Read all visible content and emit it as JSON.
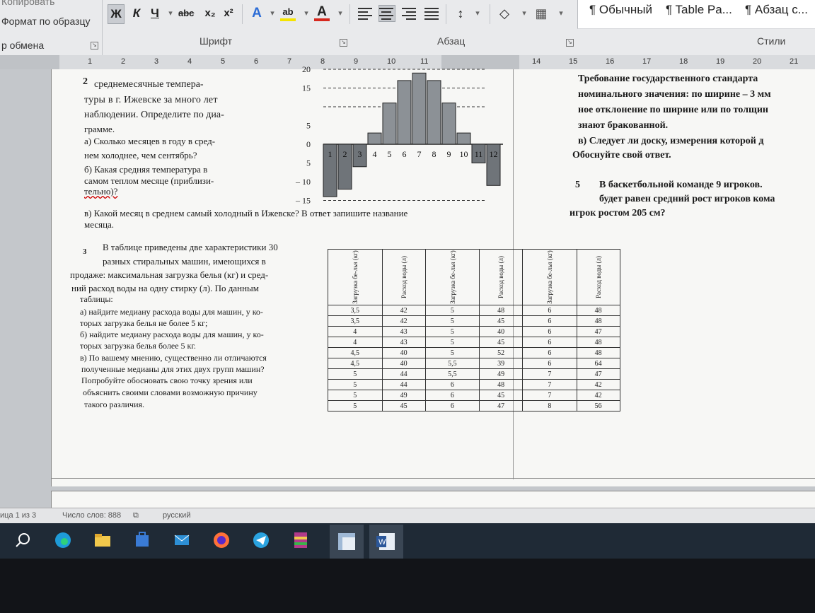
{
  "ribbon": {
    "clipboard": {
      "copy": "Копировать",
      "format_painter": "Формат по образцу",
      "group": "р обмена"
    },
    "font": {
      "group": "Шрифт",
      "bold": "Ж",
      "italic": "К",
      "underline": "Ч",
      "strike": "abc",
      "subscript": "x₂",
      "superscript": "x²",
      "text_effects": "A",
      "highlight": "ab",
      "font_color": "A"
    },
    "paragraph": {
      "group": "Абзац"
    },
    "styles": {
      "group": "Стили",
      "items": [
        "¶ Обычный",
        "¶ Table Pa...",
        "¶ Абзац с..."
      ]
    }
  },
  "ruler": {
    "left_ticks": [
      "1",
      "2",
      "3",
      "4",
      "5",
      "6",
      "7",
      "8",
      "9",
      "10",
      "11"
    ],
    "right_ticks": [
      "14",
      "15",
      "16",
      "17",
      "18",
      "19",
      "20",
      "21"
    ]
  },
  "document": {
    "task2": {
      "number": "2",
      "lines": [
        "среднемесячные темпера-",
        "туры в г. Ижевске за много лет",
        "наблюдении. Определите по диа-",
        "грамме."
      ],
      "a": [
        "а) Сколько месяцев в году в сред-",
        "нем холоднее, чем сентябрь?"
      ],
      "b": [
        "б) Какая средняя температура в",
        "самом теплом месяце (приблизи-",
        "тельно)?"
      ],
      "c": [
        "в) Какой месяц в среднем самый холодный в Ижевске? В ответ запишите название",
        "месяца."
      ]
    },
    "task3": {
      "number": "3",
      "lines": [
        "В таблице приведены две характеристики 30",
        "разных стиральных машин, имеющихся в",
        "продаже: максимальная загрузка белья (кг) и сред-",
        "ний расход воды на одну стирку (л). По данным",
        "таблицы:"
      ],
      "a": [
        "а) найдите медиану расхода воды для машин, у ко-",
        "торых загрузка белья не более 5 кг;"
      ],
      "b": [
        "б) найдите медиану расхода воды для машин, у ко-",
        "торых загрузка белья более 5 кг."
      ],
      "c": [
        "в) По вашему мнению, существенно ли отличаются",
        "полученные медианы для этих двух групп машин?",
        "Попробуйте обосновать свою точку зрения или",
        "объяснить своими словами возможную причину",
        "такого различия."
      ]
    },
    "table": {
      "headers": [
        "Загрузка бе-лья (кг)",
        "Расход воды (л)",
        "Загрузка бе-лья (кг)",
        "Расход воды (л)",
        "Загрузка бе-лья (кг)",
        "Расход воды (л)"
      ],
      "rows": [
        [
          "3,5",
          "42",
          "5",
          "48",
          "6",
          "48"
        ],
        [
          "3,5",
          "42",
          "5",
          "45",
          "6",
          "48"
        ],
        [
          "4",
          "43",
          "5",
          "40",
          "6",
          "47"
        ],
        [
          "4",
          "43",
          "5",
          "45",
          "6",
          "48"
        ],
        [
          "4,5",
          "40",
          "5",
          "52",
          "6",
          "48"
        ],
        [
          "4,5",
          "40",
          "5,5",
          "39",
          "6",
          "64"
        ],
        [
          "5",
          "44",
          "5,5",
          "49",
          "7",
          "47"
        ],
        [
          "5",
          "44",
          "6",
          "48",
          "7",
          "42"
        ],
        [
          "5",
          "49",
          "6",
          "45",
          "7",
          "42"
        ],
        [
          "5",
          "45",
          "6",
          "47",
          "8",
          "56"
        ]
      ]
    },
    "right_column": {
      "lines": [
        "Требование государственного стандарта",
        "номинального значения: по ширине – 3 мм",
        "ное отклонение по ширине или по толщин",
        "знают бракованной."
      ],
      "v": [
        "в) Следует ли доску, измерения которой д",
        "Обоснуйте свой ответ."
      ],
      "task5_number": "5",
      "task5": [
        "В баскетбольной команде 9 игроков.",
        "будет равен средний рост игроков кома",
        "игрок ростом 205 см?"
      ]
    }
  },
  "chart_data": {
    "type": "bar",
    "categories": [
      "1",
      "2",
      "3",
      "4",
      "5",
      "6",
      "7",
      "8",
      "9",
      "10",
      "11",
      "12"
    ],
    "values": [
      -14,
      -12,
      -6,
      3,
      11,
      17,
      19,
      17,
      11,
      3,
      -5,
      -11
    ],
    "ytick_labels": [
      "20",
      "15",
      "",
      "5",
      "0",
      "5",
      "– 10",
      "– 15"
    ],
    "ylim": [
      -15,
      20
    ],
    "grid": "dashed"
  },
  "status": {
    "page": "ица 1 из 3",
    "words": "Число слов: 888",
    "lang": "русский"
  },
  "taskbar": {
    "icons": [
      "search-icon",
      "edge-icon",
      "file-explorer-icon",
      "store-icon",
      "mail-icon",
      "firefox-icon",
      "telegram-icon",
      "winrar-icon",
      "generic-app-icon",
      "word-icon"
    ]
  }
}
